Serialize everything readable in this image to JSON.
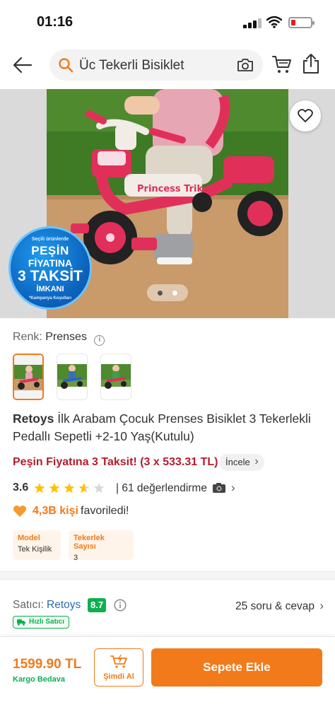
{
  "status": {
    "time": "01:16"
  },
  "header": {
    "search_text": "Üc Tekerli Bisiklet",
    "icons": [
      "back-arrow-icon",
      "search-icon",
      "camera-icon",
      "cart-icon",
      "share-icon"
    ]
  },
  "gallery": {
    "promo": {
      "top_small": "Seçili ürünlerde",
      "line1": "PEŞİN",
      "line2": "FİYATINA",
      "line3": "3 TAKSİT",
      "line4": "İMKANI",
      "bottom_small": "*Kampanya Koşulları"
    },
    "active_page": 1,
    "page_count": 2
  },
  "variant": {
    "label": "Renk:",
    "value": "Prenses",
    "options": [
      "pink-princess",
      "blue",
      "green"
    ],
    "selected_index": 0
  },
  "product": {
    "brand": "Retoys",
    "name": "İlk Arabam Çocuk Prenses Bisiklet 3 Tekerlekli Pedallı Sepetli +2-10 Yaş(Kutulu)",
    "installment_text": "Peşin Fiyatına 3 Taksit! (3 x 533.31 TL)",
    "inspect_label": "İncele",
    "rating": "3.6",
    "rating_value": 3.6,
    "review_count_text": "| 61 değerlendirme",
    "favorites_count": "4,3B kişi",
    "favorites_text": "favoriledi!",
    "specs": [
      {
        "title": "Model",
        "value": "Tek Kişilik"
      },
      {
        "title": "Tekerlek Sayısı",
        "value": "3"
      }
    ]
  },
  "seller": {
    "prefix": "Satıcı:",
    "name": "Retoys",
    "score": "8.7",
    "qa_text": "25 soru & cevap",
    "fast_badge": "Hızlı Satıcı"
  },
  "bottom": {
    "price": "1599.90 TL",
    "shipping": "Kargo Bedava",
    "buy_now": "Şimdi Al",
    "add_to_cart": "Sepete Ekle"
  },
  "colors": {
    "accent": "#f27a1a",
    "installment_red": "#b31d2b",
    "seller_green": "#0bb14e",
    "seller_blue": "#2a6bb2"
  }
}
